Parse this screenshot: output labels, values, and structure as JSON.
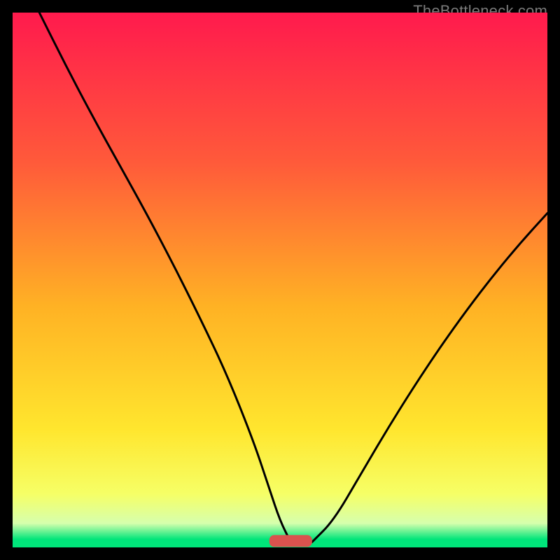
{
  "watermark": "TheBottleneck.com",
  "chart_data": {
    "type": "line",
    "title": "",
    "xlabel": "",
    "ylabel": "",
    "xlim": [
      0,
      100
    ],
    "ylim": [
      0,
      100
    ],
    "grid": false,
    "legend": false,
    "background_gradient": {
      "stops": [
        {
          "offset": 0.0,
          "color": "#ff1a4d"
        },
        {
          "offset": 0.28,
          "color": "#ff5a3a"
        },
        {
          "offset": 0.55,
          "color": "#ffb224"
        },
        {
          "offset": 0.78,
          "color": "#ffe62e"
        },
        {
          "offset": 0.9,
          "color": "#f6ff66"
        },
        {
          "offset": 0.955,
          "color": "#d6ffad"
        },
        {
          "offset": 0.985,
          "color": "#00e57a"
        },
        {
          "offset": 1.0,
          "color": "#00e57a"
        }
      ]
    },
    "optimum_marker": {
      "x": 52,
      "y": 1.2,
      "width": 8,
      "height": 2.2,
      "color": "#d9524e"
    },
    "series": [
      {
        "name": "curve-left",
        "x": [
          5,
          10,
          15,
          20,
          25,
          30,
          35,
          40,
          45,
          48,
          50,
          52
        ],
        "values": [
          100,
          90,
          80.5,
          71.5,
          62.5,
          53,
          43,
          32.5,
          20,
          11,
          5,
          1
        ]
      },
      {
        "name": "curve-right",
        "x": [
          56,
          60,
          65,
          70,
          75,
          80,
          85,
          90,
          95,
          100
        ],
        "values": [
          1,
          5,
          13.5,
          22,
          30,
          37.5,
          44.5,
          51,
          57,
          62.5
        ]
      }
    ]
  }
}
